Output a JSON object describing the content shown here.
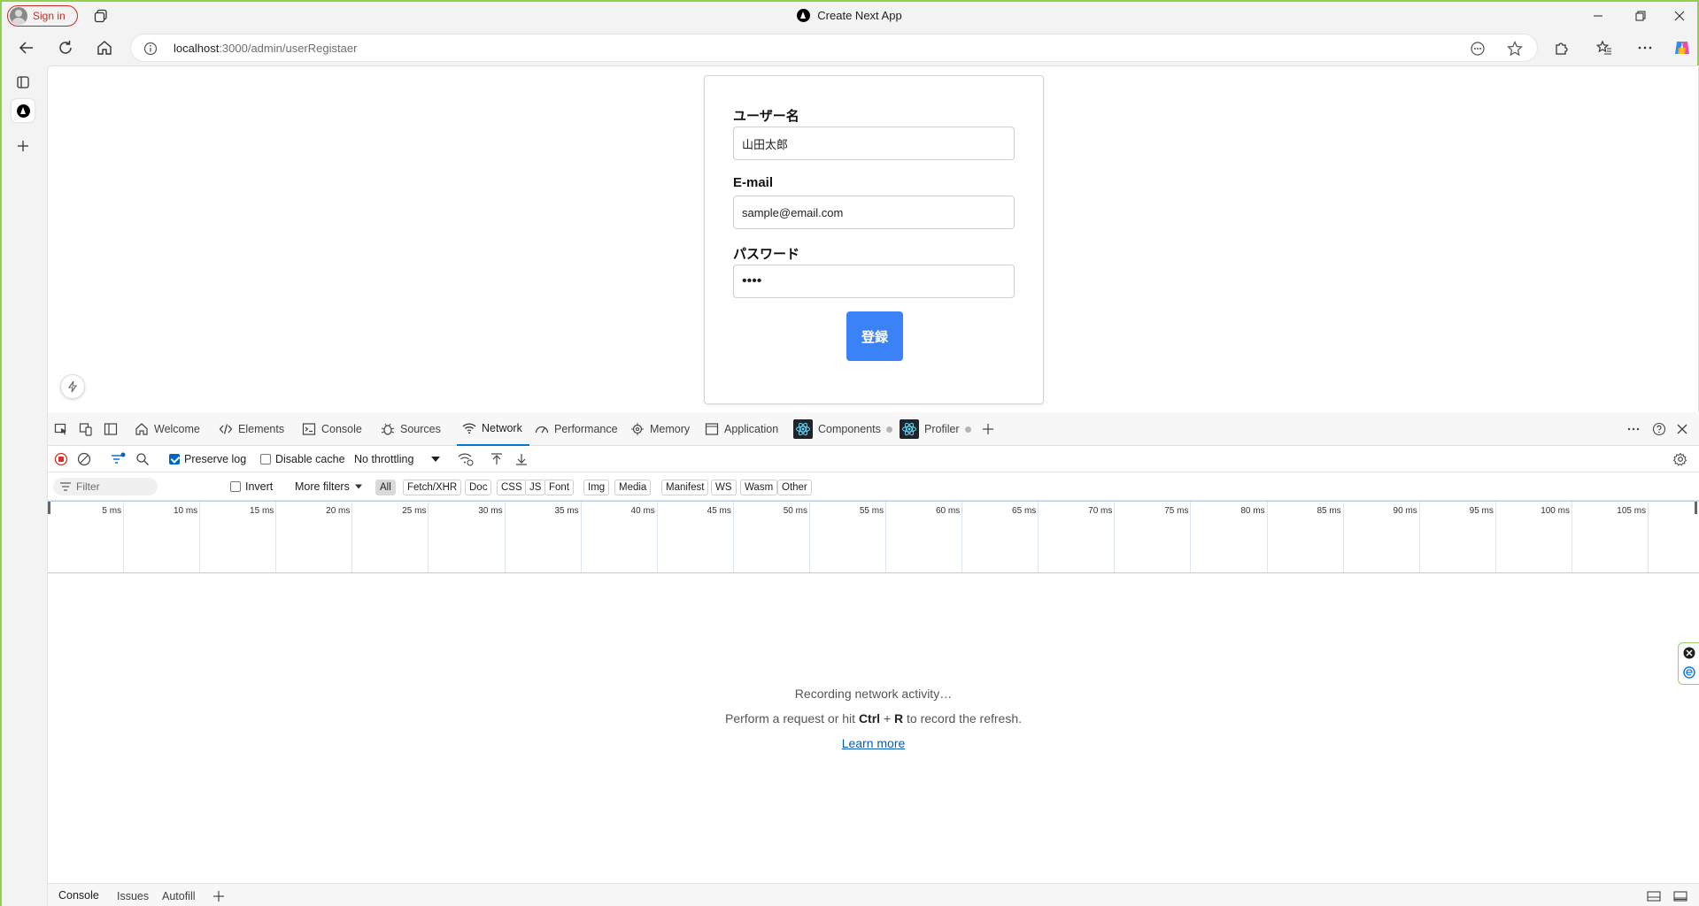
{
  "window": {
    "title": "Create Next App",
    "sign_in_label": "Sign in",
    "accent_frame_color": "#8fd14f"
  },
  "address_bar": {
    "url_host": "localhost",
    "url_path": ":3000/admin/userRegistaer"
  },
  "form": {
    "username_label": "ユーザー名",
    "username_value": "山田太郎",
    "email_label": "E-mail",
    "email_value": "sample@email.com",
    "password_label": "パスワード",
    "password_value": "••••",
    "submit_label": "登録",
    "submit_color": "#3b82f6"
  },
  "devtools": {
    "tabs": [
      {
        "label": "Welcome",
        "icon": "home-icon"
      },
      {
        "label": "Elements",
        "icon": "code-icon"
      },
      {
        "label": "Console",
        "icon": "console-icon"
      },
      {
        "label": "Sources",
        "icon": "bug-icon"
      },
      {
        "label": "Network",
        "icon": "wifi-icon",
        "active": true
      },
      {
        "label": "Performance",
        "icon": "gauge-icon"
      },
      {
        "label": "Memory",
        "icon": "chip-icon"
      },
      {
        "label": "Application",
        "icon": "window-icon"
      },
      {
        "label": "Components",
        "icon": "react-icon"
      },
      {
        "label": "Profiler",
        "icon": "react-icon"
      }
    ],
    "toolbar": {
      "preserve_log": "Preserve log",
      "preserve_log_checked": true,
      "disable_cache": "Disable cache",
      "disable_cache_checked": false,
      "throttling": "No throttling"
    },
    "filter": {
      "placeholder": "Filter",
      "invert": "Invert",
      "more_filters": "More filters",
      "types": [
        "All",
        "Fetch/XHR",
        "Doc",
        "CSS",
        "JS",
        "Font",
        "Img",
        "Media",
        "Manifest",
        "WS",
        "Wasm",
        "Other"
      ],
      "selected_type": "All"
    },
    "timeline_ticks": [
      "5 ms",
      "10 ms",
      "15 ms",
      "20 ms",
      "25 ms",
      "30 ms",
      "35 ms",
      "40 ms",
      "45 ms",
      "50 ms",
      "55 ms",
      "60 ms",
      "65 ms",
      "70 ms",
      "75 ms",
      "80 ms",
      "85 ms",
      "90 ms",
      "95 ms",
      "100 ms",
      "105 ms"
    ],
    "empty_state": {
      "line1": "Recording network activity…",
      "line2_pre": "Perform a request or hit ",
      "line2_key1": "Ctrl",
      "line2_plus": " + ",
      "line2_key2": "R",
      "line2_post": " to record the refresh.",
      "learn_more": "Learn more"
    },
    "drawer_tabs": [
      "Console",
      "Issues",
      "Autofill"
    ]
  }
}
